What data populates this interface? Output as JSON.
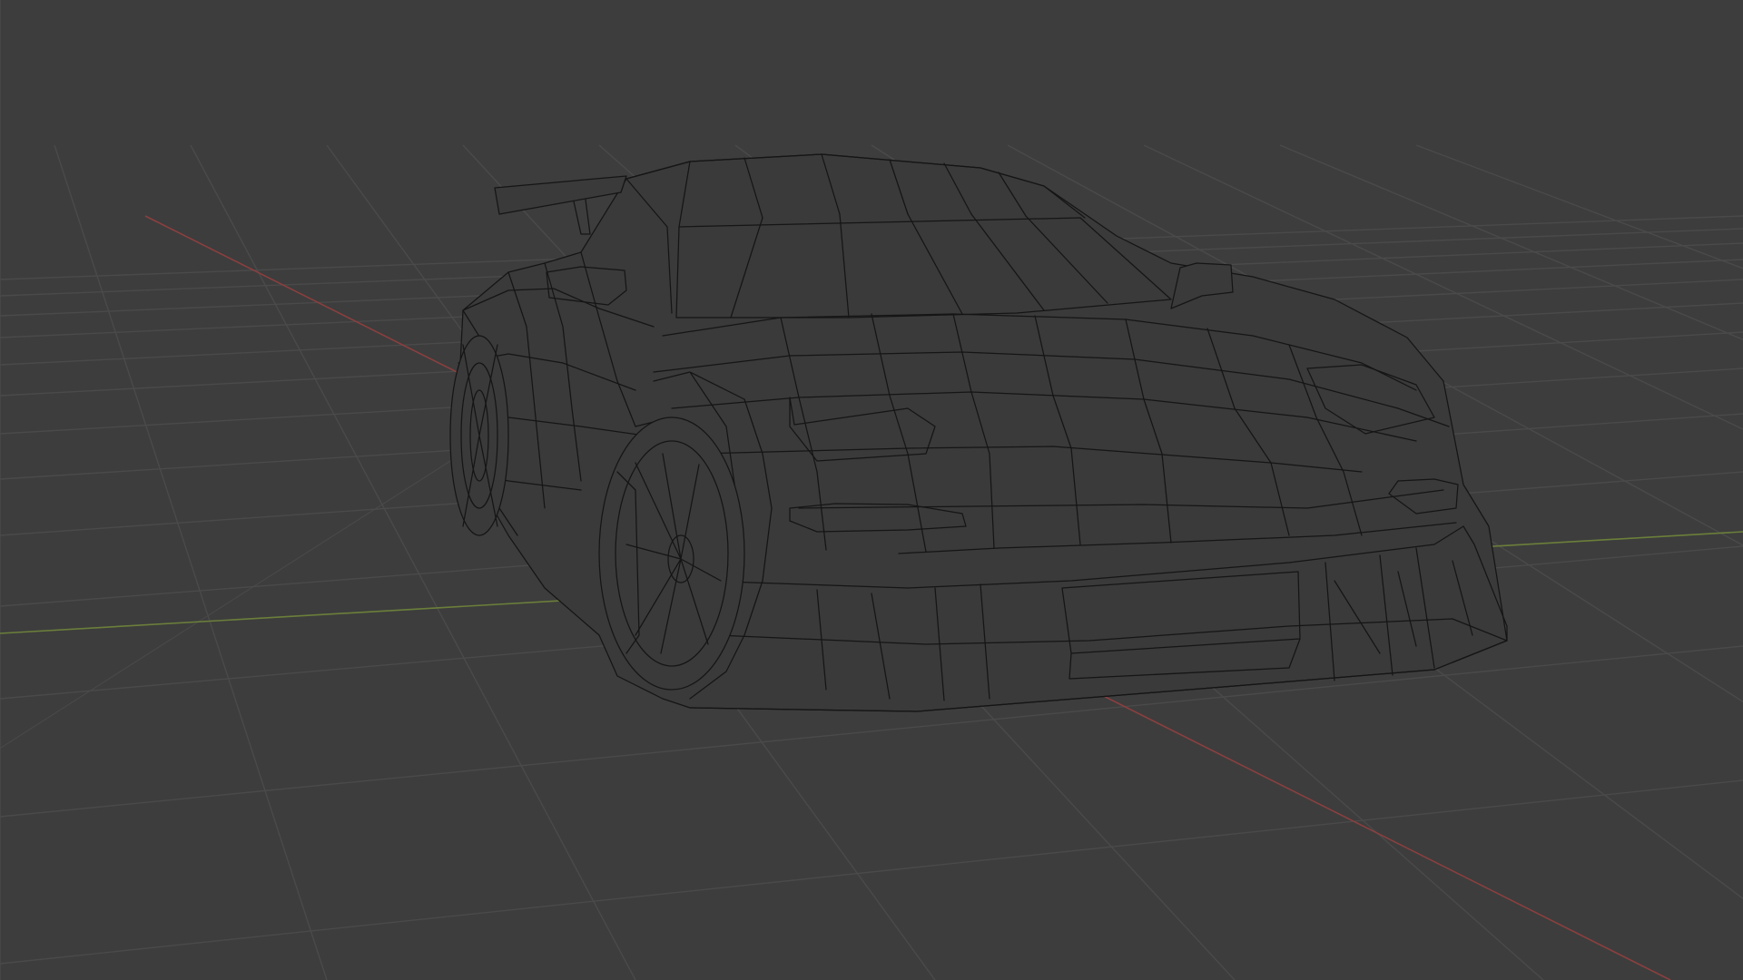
{
  "viewport": {
    "mode": "wireframe",
    "object": "car-mesh",
    "colors": {
      "background": "#3d3d3d",
      "grid": "#4a4a4a",
      "x_axis": "#8a3f3f",
      "y_axis": "#6b7f3a",
      "wire": "#151515",
      "mesh_fill": "#3a3a3a"
    }
  }
}
